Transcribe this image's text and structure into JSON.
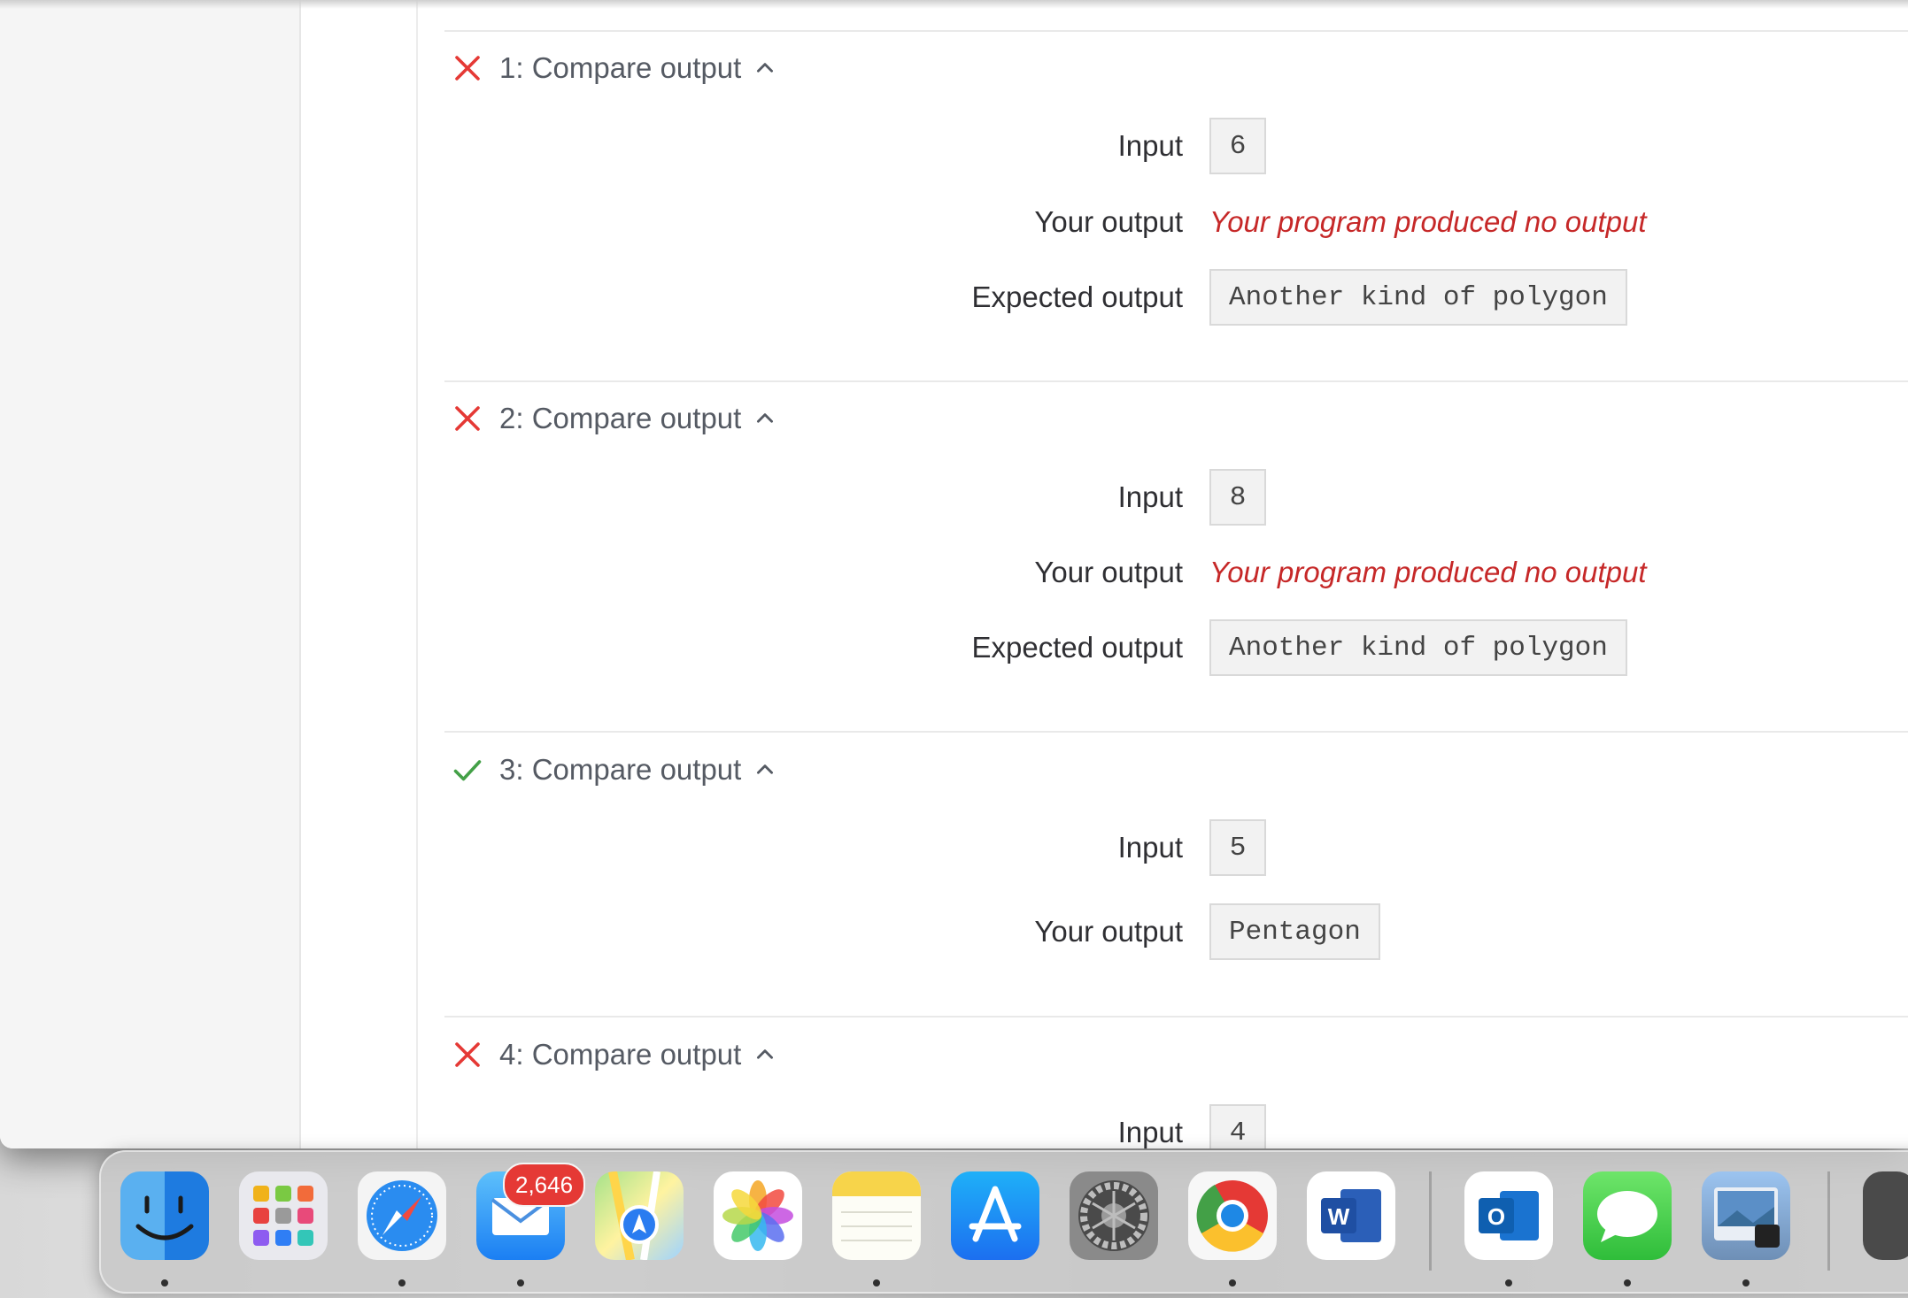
{
  "labels": {
    "input": "Input",
    "your_output": "Your output",
    "expected_output": "Expected output",
    "no_output": "Your program produced no output"
  },
  "tests": [
    {
      "title": "1: Compare output",
      "status": "failed",
      "input": "6",
      "expected": "Another kind of polygon"
    },
    {
      "title": "2: Compare output",
      "status": "failed",
      "input": "8",
      "expected": "Another kind of polygon"
    },
    {
      "title": "3: Compare output",
      "status": "passed",
      "input": "5",
      "your_output": "Pentagon"
    },
    {
      "title": "4: Compare output",
      "status": "failed",
      "input": "4"
    }
  ],
  "colors": {
    "fail": "#e53935",
    "pass": "#43a047",
    "no_output": "#c62828"
  },
  "dock": {
    "mail_badge": "2,646",
    "apps": [
      "finder-icon",
      "launchpad-icon",
      "safari-icon",
      "mail-icon",
      "maps-icon",
      "photos-icon",
      "notes-icon",
      "app-store-icon",
      "system-preferences-icon",
      "chrome-icon",
      "word-icon",
      "outlook-icon",
      "messages-icon",
      "preview-icon"
    ]
  }
}
